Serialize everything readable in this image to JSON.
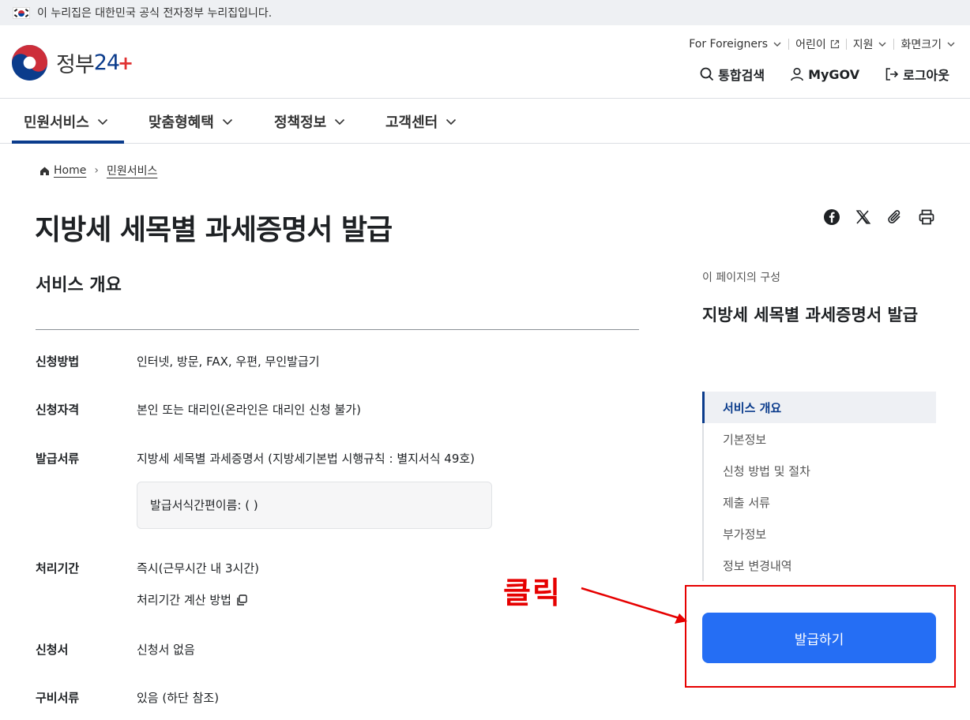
{
  "govbar": {
    "text": "이 누리집은 대한민국 공식 전자정부 누리집입니다."
  },
  "logo": {
    "text_main": "정부",
    "text_num": "24",
    "text_plus": "+"
  },
  "utility": {
    "foreigners": "For Foreigners",
    "kids": "어린이",
    "support": "지원",
    "screen_size": "화면크기"
  },
  "tools": {
    "search": "통합검색",
    "mygov": "MyGOV",
    "logout": "로그아웃"
  },
  "gnb": {
    "items": [
      {
        "label": "민원서비스"
      },
      {
        "label": "맞춤형혜택"
      },
      {
        "label": "정책정보"
      },
      {
        "label": "고객센터"
      }
    ]
  },
  "breadcrumb": {
    "home": "Home",
    "current": "민원서비스"
  },
  "page": {
    "title": "지방세 세목별 과세증명서 발급"
  },
  "overview": {
    "title": "서비스 개요",
    "rows": [
      {
        "label": "신청방법",
        "value": "인터넷, 방문, FAX, 우편, 무인발급기"
      },
      {
        "label": "신청자격",
        "value": "본인 또는 대리인(온라인은 대리인 신청 불가)"
      },
      {
        "label": "발급서류",
        "value": "지방세 세목별 과세증명서 (지방세기본법 시행규칙 : 별지서식 49호)"
      },
      {
        "label": "처리기간",
        "value": "즉시(근무시간 내 3시간)"
      },
      {
        "label": "신청서",
        "value": "신청서 없음"
      },
      {
        "label": "구비서류",
        "value": "있음 (하단 참조)"
      }
    ],
    "infobox": "발급서식간편이름: ( )",
    "calc_link": "처리기간 계산 방법"
  },
  "toc": {
    "caption": "이 페이지의 구성",
    "title": "지방세 세목별 과세증명서 발급",
    "items": [
      {
        "label": "서비스 개요"
      },
      {
        "label": "기본정보"
      },
      {
        "label": "신청 방법 및 절차"
      },
      {
        "label": "제출 서류"
      },
      {
        "label": "부가정보"
      },
      {
        "label": "정보 변경내역"
      }
    ]
  },
  "action": {
    "issue_label": "발급하기"
  },
  "annotation": {
    "text": "클릭",
    "color": "#e60000"
  },
  "colors": {
    "primary": "#256ef4",
    "navy": "#0b3c8c"
  }
}
